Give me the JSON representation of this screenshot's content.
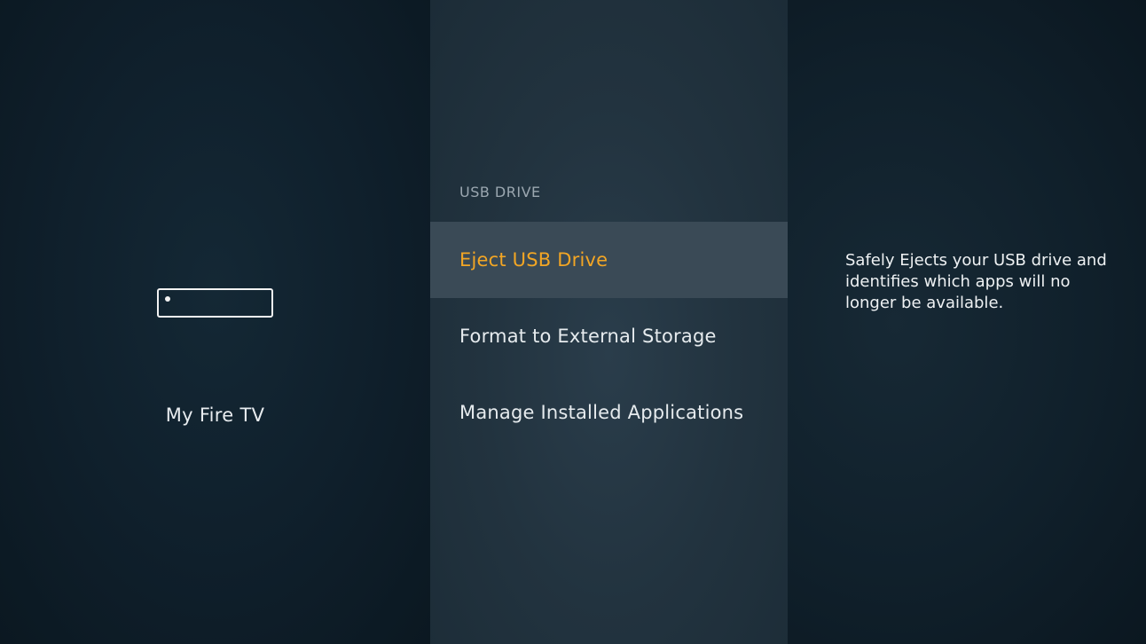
{
  "left_panel": {
    "icon": "fire-tv-device-icon",
    "device_name": "My Fire TV"
  },
  "menu": {
    "section_header": "USB DRIVE",
    "items": [
      {
        "label": "Eject USB Drive",
        "selected": true
      },
      {
        "label": "Format to External Storage",
        "selected": false
      },
      {
        "label": "Manage Installed Applications",
        "selected": false
      }
    ]
  },
  "right_panel": {
    "description": "Safely Ejects your USB drive and identifies which apps will no longer be available."
  },
  "colors": {
    "selected_text": "#f3a624",
    "selected_background": "#3a4a56",
    "text": "#e6ebee",
    "header_text": "#9ba7b0"
  }
}
